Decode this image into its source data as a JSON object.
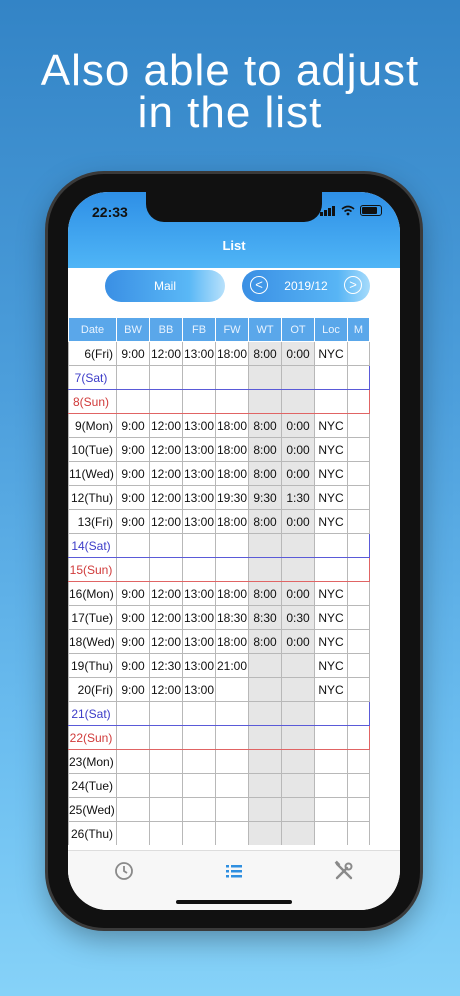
{
  "headline": [
    "Also able to adjust",
    "in the list"
  ],
  "status": {
    "time": "22:33"
  },
  "nav": {
    "title": "List"
  },
  "toolbar": {
    "mail_label": "Mail",
    "month": "2019/12",
    "prev": "<",
    "next": ">"
  },
  "table": {
    "columns": [
      "Date",
      "BW",
      "BB",
      "FB",
      "FW",
      "WT",
      "OT",
      "Loc",
      "M"
    ],
    "rows": [
      {
        "type": "weekday",
        "cells": [
          "6(Fri)",
          "9:00",
          "12:00",
          "13:00",
          "18:00",
          "8:00",
          "0:00",
          "NYC",
          ""
        ]
      },
      {
        "type": "sat",
        "cells": [
          "7(Sat)",
          "",
          "",
          "",
          "",
          "",
          "",
          "",
          ""
        ]
      },
      {
        "type": "sun",
        "cells": [
          "8(Sun)",
          "",
          "",
          "",
          "",
          "",
          "",
          "",
          ""
        ]
      },
      {
        "type": "weekday",
        "cells": [
          "9(Mon)",
          "9:00",
          "12:00",
          "13:00",
          "18:00",
          "8:00",
          "0:00",
          "NYC",
          ""
        ]
      },
      {
        "type": "weekday",
        "cells": [
          "10(Tue)",
          "9:00",
          "12:00",
          "13:00",
          "18:00",
          "8:00",
          "0:00",
          "NYC",
          ""
        ]
      },
      {
        "type": "weekday",
        "cells": [
          "11(Wed)",
          "9:00",
          "12:00",
          "13:00",
          "18:00",
          "8:00",
          "0:00",
          "NYC",
          ""
        ]
      },
      {
        "type": "weekday",
        "cells": [
          "12(Thu)",
          "9:00",
          "12:00",
          "13:00",
          "19:30",
          "9:30",
          "1:30",
          "NYC",
          ""
        ]
      },
      {
        "type": "weekday",
        "cells": [
          "13(Fri)",
          "9:00",
          "12:00",
          "13:00",
          "18:00",
          "8:00",
          "0:00",
          "NYC",
          ""
        ]
      },
      {
        "type": "sat",
        "cells": [
          "14(Sat)",
          "",
          "",
          "",
          "",
          "",
          "",
          "",
          ""
        ]
      },
      {
        "type": "sun",
        "cells": [
          "15(Sun)",
          "",
          "",
          "",
          "",
          "",
          "",
          "",
          ""
        ]
      },
      {
        "type": "weekday",
        "cells": [
          "16(Mon)",
          "9:00",
          "12:00",
          "13:00",
          "18:00",
          "8:00",
          "0:00",
          "NYC",
          ""
        ]
      },
      {
        "type": "weekday",
        "cells": [
          "17(Tue)",
          "9:00",
          "12:00",
          "13:00",
          "18:30",
          "8:30",
          "0:30",
          "NYC",
          ""
        ]
      },
      {
        "type": "weekday",
        "cells": [
          "18(Wed)",
          "9:00",
          "12:00",
          "13:00",
          "18:00",
          "8:00",
          "0:00",
          "NYC",
          ""
        ]
      },
      {
        "type": "weekday",
        "cells": [
          "19(Thu)",
          "9:00",
          "12:30",
          "13:00",
          "21:00",
          "",
          "",
          "NYC",
          ""
        ]
      },
      {
        "type": "weekday",
        "cells": [
          "20(Fri)",
          "9:00",
          "12:00",
          "13:00",
          "",
          "",
          "",
          "NYC",
          ""
        ]
      },
      {
        "type": "sat",
        "cells": [
          "21(Sat)",
          "",
          "",
          "",
          "",
          "",
          "",
          "",
          ""
        ]
      },
      {
        "type": "sun",
        "cells": [
          "22(Sun)",
          "",
          "",
          "",
          "",
          "",
          "",
          "",
          ""
        ]
      },
      {
        "type": "weekday",
        "cells": [
          "23(Mon)",
          "",
          "",
          "",
          "",
          "",
          "",
          "",
          ""
        ]
      },
      {
        "type": "weekday",
        "cells": [
          "24(Tue)",
          "",
          "",
          "",
          "",
          "",
          "",
          "",
          ""
        ]
      },
      {
        "type": "weekday",
        "cells": [
          "25(Wed)",
          "",
          "",
          "",
          "",
          "",
          "",
          "",
          ""
        ]
      },
      {
        "type": "weekday",
        "cells": [
          "26(Thu)",
          "",
          "",
          "",
          "",
          "",
          "",
          "",
          ""
        ]
      }
    ]
  },
  "tabs": [
    {
      "name": "clock-icon",
      "active": false
    },
    {
      "name": "list-icon",
      "active": true
    },
    {
      "name": "tools-icon",
      "active": false
    }
  ],
  "colors": {
    "accent": "#3a8fe4",
    "sat": "#3c3cc8",
    "sun": "#d03a3a",
    "active_tab": "#2f8fe0",
    "inactive_tab": "#8a8a8a"
  }
}
